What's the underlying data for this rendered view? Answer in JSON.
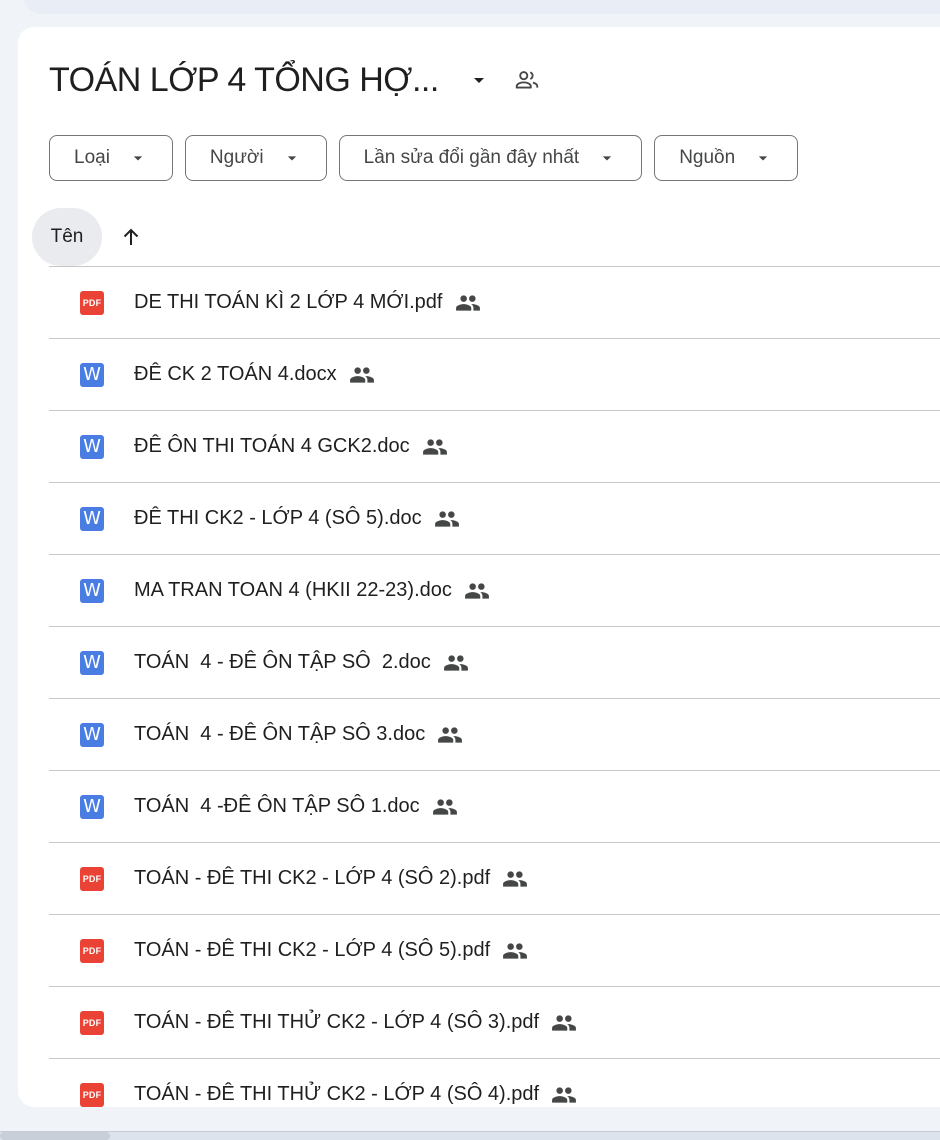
{
  "folder": {
    "title": "TOÁN LỚP 4 TỔNG HỢ...",
    "title_caret_icon": "arrow-drop-down-icon",
    "shared_icon": "people-outline-icon"
  },
  "filters": [
    {
      "label": "Loại"
    },
    {
      "label": "Người"
    },
    {
      "label": "Lần sửa đổi gần đây nhất"
    },
    {
      "label": "Nguồn"
    }
  ],
  "sort": {
    "label": "Tên",
    "direction_icon": "arrow-upward-icon"
  },
  "files": [
    {
      "name": "DE THI TOÁN KÌ 2 LỚP 4 MỚI.pdf",
      "type": "pdf",
      "type_label": "PDF",
      "shared": true
    },
    {
      "name": "ĐÊ CK 2 TOÁN 4.docx",
      "type": "word",
      "type_label": "W",
      "shared": true
    },
    {
      "name": "ĐÊ ÔN THI TOÁN 4 GCK2.doc",
      "type": "word",
      "type_label": "W",
      "shared": true
    },
    {
      "name": "ĐÊ THI CK2 - LỚP 4 (SÔ 5).doc",
      "type": "word",
      "type_label": "W",
      "shared": true
    },
    {
      "name": "MA TRAN TOAN 4 (HKII 22-23).doc",
      "type": "word",
      "type_label": "W",
      "shared": true
    },
    {
      "name": "TOÁN  4 - ĐÊ ÔN TẬP SÔ  2.doc",
      "type": "word",
      "type_label": "W",
      "shared": true
    },
    {
      "name": "TOÁN  4 - ĐÊ ÔN TẬP SÔ 3.doc",
      "type": "word",
      "type_label": "W",
      "shared": true
    },
    {
      "name": "TOÁN  4 -ĐÊ ÔN TẬP SÔ 1.doc",
      "type": "word",
      "type_label": "W",
      "shared": true
    },
    {
      "name": "TOÁN - ĐÊ THI CK2 - LỚP 4 (SÔ 2).pdf",
      "type": "pdf",
      "type_label": "PDF",
      "shared": true
    },
    {
      "name": "TOÁN - ĐÊ THI CK2 - LỚP 4 (SÔ 5).pdf",
      "type": "pdf",
      "type_label": "PDF",
      "shared": true
    },
    {
      "name": "TOÁN - ĐÊ THI THỬ CK2 - LỚP 4 (SÔ 3).pdf",
      "type": "pdf",
      "type_label": "PDF",
      "shared": true
    },
    {
      "name": "TOÁN - ĐÊ THI THỬ CK2 - LỚP 4 (SÔ 4).pdf",
      "type": "pdf",
      "type_label": "PDF",
      "shared": true
    }
  ],
  "colors": {
    "pdf": "#ea4335",
    "word": "#4a7de3",
    "text": "#1f1f1f",
    "chip_border": "#747775",
    "sort_pill": "#e9ebef",
    "divider": "#c7c7c7"
  }
}
